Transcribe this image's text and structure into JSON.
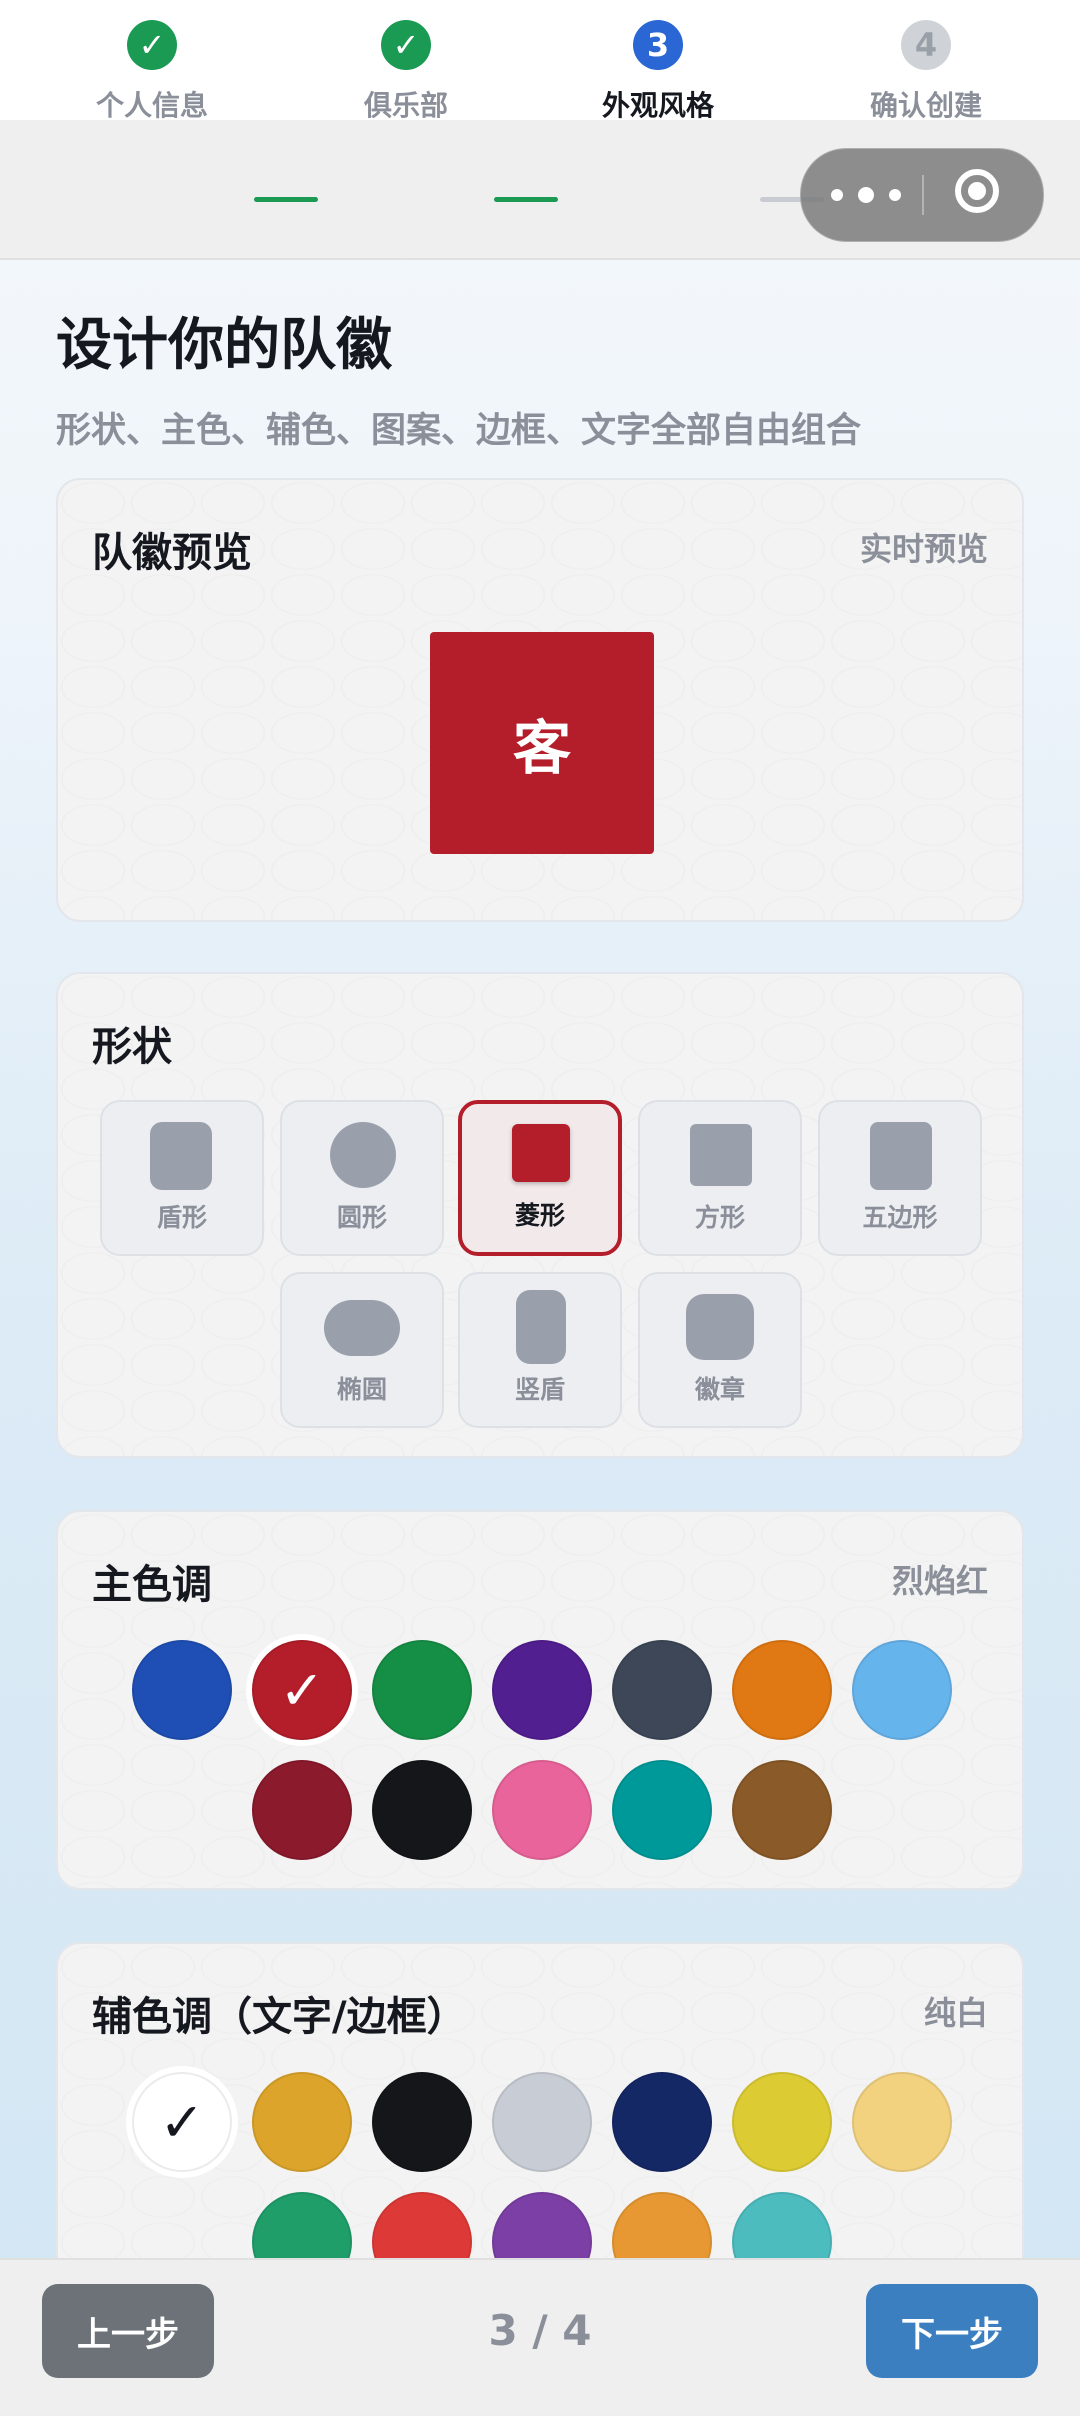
{
  "steps": [
    {
      "label": "个人信息",
      "state": "done",
      "mark": "✓"
    },
    {
      "label": "俱乐部",
      "state": "done",
      "mark": "✓"
    },
    {
      "label": "外观风格",
      "state": "current",
      "mark": "3"
    },
    {
      "label": "确认创建",
      "state": "todo",
      "mark": "4"
    }
  ],
  "page": {
    "title": "设计你的队徽",
    "subtitle": "形状、主色、辅色、图案、边框、文字全部自由组合"
  },
  "preview": {
    "title": "队徽预览",
    "hint": "实时预览",
    "badge_text": "客",
    "badge_color": "#b31e2a"
  },
  "shape": {
    "title": "形状",
    "selected": "菱形",
    "options": [
      "盾形",
      "圆形",
      "菱形",
      "方形",
      "五边形",
      "椭圆",
      "竖盾",
      "徽章"
    ]
  },
  "primary": {
    "title": "主色调",
    "selected_name": "烈焰红",
    "check": "✓",
    "colors": [
      "#1f4fb5",
      "#b31e2a",
      "#168f46",
      "#521f91",
      "#3d4757",
      "#e07813",
      "#66b4ec",
      "#8a1a2c",
      "#15161a",
      "#e8649a",
      "#00999a",
      "#8a5a28"
    ]
  },
  "secondary": {
    "title": "辅色调（文字/边框）",
    "selected_name": "纯白",
    "check": "✓",
    "colors": [
      "#ffffff",
      "#dca42a",
      "#15161a",
      "#c8ccd4",
      "#152866",
      "#dccb33",
      "#f2d27f",
      "#1f9e6a",
      "#dd3a37",
      "#7c3fa6",
      "#e89833",
      "#4dbcbf"
    ]
  },
  "footer": {
    "prev": "上一步",
    "pager": "3 / 4",
    "next": "下一步"
  }
}
